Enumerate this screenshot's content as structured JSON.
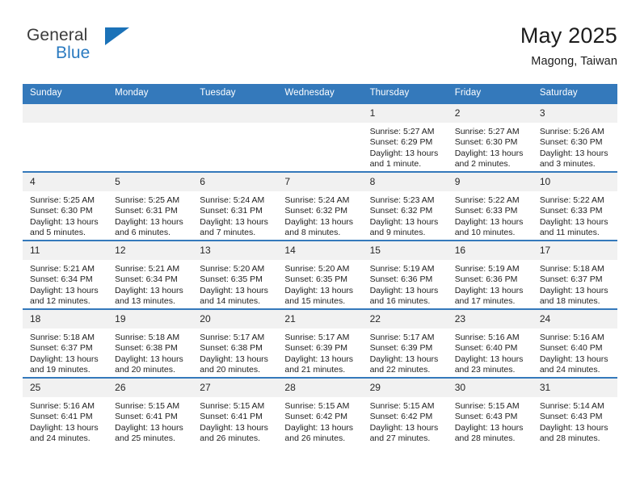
{
  "brand": {
    "name_part1": "General",
    "name_part2": "Blue",
    "mark": "triangle-flag-icon"
  },
  "header": {
    "title": "May 2025",
    "location": "Magong, Taiwan"
  },
  "weekday_headers": [
    "Sunday",
    "Monday",
    "Tuesday",
    "Wednesday",
    "Thursday",
    "Friday",
    "Saturday"
  ],
  "colors": {
    "header_blue": "#3479bb",
    "brand_blue": "#2a7ac0",
    "daynum_band": "#f1f1f1",
    "text": "#1f1f1f"
  },
  "labels": {
    "sunrise_prefix": "Sunrise:",
    "sunset_prefix": "Sunset:",
    "daylight_prefix": "Daylight:"
  },
  "weeks": [
    [
      {
        "day": "",
        "sunrise": "",
        "sunset": "",
        "daylight": "",
        "empty": true
      },
      {
        "day": "",
        "sunrise": "",
        "sunset": "",
        "daylight": "",
        "empty": true
      },
      {
        "day": "",
        "sunrise": "",
        "sunset": "",
        "daylight": "",
        "empty": true
      },
      {
        "day": "",
        "sunrise": "",
        "sunset": "",
        "daylight": "",
        "empty": true
      },
      {
        "day": "1",
        "sunrise": "Sunrise: 5:27 AM",
        "sunset": "Sunset: 6:29 PM",
        "daylight": "Daylight: 13 hours and 1 minute.",
        "empty": false
      },
      {
        "day": "2",
        "sunrise": "Sunrise: 5:27 AM",
        "sunset": "Sunset: 6:30 PM",
        "daylight": "Daylight: 13 hours and 2 minutes.",
        "empty": false
      },
      {
        "day": "3",
        "sunrise": "Sunrise: 5:26 AM",
        "sunset": "Sunset: 6:30 PM",
        "daylight": "Daylight: 13 hours and 3 minutes.",
        "empty": false
      }
    ],
    [
      {
        "day": "4",
        "sunrise": "Sunrise: 5:25 AM",
        "sunset": "Sunset: 6:30 PM",
        "daylight": "Daylight: 13 hours and 5 minutes.",
        "empty": false
      },
      {
        "day": "5",
        "sunrise": "Sunrise: 5:25 AM",
        "sunset": "Sunset: 6:31 PM",
        "daylight": "Daylight: 13 hours and 6 minutes.",
        "empty": false
      },
      {
        "day": "6",
        "sunrise": "Sunrise: 5:24 AM",
        "sunset": "Sunset: 6:31 PM",
        "daylight": "Daylight: 13 hours and 7 minutes.",
        "empty": false
      },
      {
        "day": "7",
        "sunrise": "Sunrise: 5:24 AM",
        "sunset": "Sunset: 6:32 PM",
        "daylight": "Daylight: 13 hours and 8 minutes.",
        "empty": false
      },
      {
        "day": "8",
        "sunrise": "Sunrise: 5:23 AM",
        "sunset": "Sunset: 6:32 PM",
        "daylight": "Daylight: 13 hours and 9 minutes.",
        "empty": false
      },
      {
        "day": "9",
        "sunrise": "Sunrise: 5:22 AM",
        "sunset": "Sunset: 6:33 PM",
        "daylight": "Daylight: 13 hours and 10 minutes.",
        "empty": false
      },
      {
        "day": "10",
        "sunrise": "Sunrise: 5:22 AM",
        "sunset": "Sunset: 6:33 PM",
        "daylight": "Daylight: 13 hours and 11 minutes.",
        "empty": false
      }
    ],
    [
      {
        "day": "11",
        "sunrise": "Sunrise: 5:21 AM",
        "sunset": "Sunset: 6:34 PM",
        "daylight": "Daylight: 13 hours and 12 minutes.",
        "empty": false
      },
      {
        "day": "12",
        "sunrise": "Sunrise: 5:21 AM",
        "sunset": "Sunset: 6:34 PM",
        "daylight": "Daylight: 13 hours and 13 minutes.",
        "empty": false
      },
      {
        "day": "13",
        "sunrise": "Sunrise: 5:20 AM",
        "sunset": "Sunset: 6:35 PM",
        "daylight": "Daylight: 13 hours and 14 minutes.",
        "empty": false
      },
      {
        "day": "14",
        "sunrise": "Sunrise: 5:20 AM",
        "sunset": "Sunset: 6:35 PM",
        "daylight": "Daylight: 13 hours and 15 minutes.",
        "empty": false
      },
      {
        "day": "15",
        "sunrise": "Sunrise: 5:19 AM",
        "sunset": "Sunset: 6:36 PM",
        "daylight": "Daylight: 13 hours and 16 minutes.",
        "empty": false
      },
      {
        "day": "16",
        "sunrise": "Sunrise: 5:19 AM",
        "sunset": "Sunset: 6:36 PM",
        "daylight": "Daylight: 13 hours and 17 minutes.",
        "empty": false
      },
      {
        "day": "17",
        "sunrise": "Sunrise: 5:18 AM",
        "sunset": "Sunset: 6:37 PM",
        "daylight": "Daylight: 13 hours and 18 minutes.",
        "empty": false
      }
    ],
    [
      {
        "day": "18",
        "sunrise": "Sunrise: 5:18 AM",
        "sunset": "Sunset: 6:37 PM",
        "daylight": "Daylight: 13 hours and 19 minutes.",
        "empty": false
      },
      {
        "day": "19",
        "sunrise": "Sunrise: 5:18 AM",
        "sunset": "Sunset: 6:38 PM",
        "daylight": "Daylight: 13 hours and 20 minutes.",
        "empty": false
      },
      {
        "day": "20",
        "sunrise": "Sunrise: 5:17 AM",
        "sunset": "Sunset: 6:38 PM",
        "daylight": "Daylight: 13 hours and 20 minutes.",
        "empty": false
      },
      {
        "day": "21",
        "sunrise": "Sunrise: 5:17 AM",
        "sunset": "Sunset: 6:39 PM",
        "daylight": "Daylight: 13 hours and 21 minutes.",
        "empty": false
      },
      {
        "day": "22",
        "sunrise": "Sunrise: 5:17 AM",
        "sunset": "Sunset: 6:39 PM",
        "daylight": "Daylight: 13 hours and 22 minutes.",
        "empty": false
      },
      {
        "day": "23",
        "sunrise": "Sunrise: 5:16 AM",
        "sunset": "Sunset: 6:40 PM",
        "daylight": "Daylight: 13 hours and 23 minutes.",
        "empty": false
      },
      {
        "day": "24",
        "sunrise": "Sunrise: 5:16 AM",
        "sunset": "Sunset: 6:40 PM",
        "daylight": "Daylight: 13 hours and 24 minutes.",
        "empty": false
      }
    ],
    [
      {
        "day": "25",
        "sunrise": "Sunrise: 5:16 AM",
        "sunset": "Sunset: 6:41 PM",
        "daylight": "Daylight: 13 hours and 24 minutes.",
        "empty": false
      },
      {
        "day": "26",
        "sunrise": "Sunrise: 5:15 AM",
        "sunset": "Sunset: 6:41 PM",
        "daylight": "Daylight: 13 hours and 25 minutes.",
        "empty": false
      },
      {
        "day": "27",
        "sunrise": "Sunrise: 5:15 AM",
        "sunset": "Sunset: 6:41 PM",
        "daylight": "Daylight: 13 hours and 26 minutes.",
        "empty": false
      },
      {
        "day": "28",
        "sunrise": "Sunrise: 5:15 AM",
        "sunset": "Sunset: 6:42 PM",
        "daylight": "Daylight: 13 hours and 26 minutes.",
        "empty": false
      },
      {
        "day": "29",
        "sunrise": "Sunrise: 5:15 AM",
        "sunset": "Sunset: 6:42 PM",
        "daylight": "Daylight: 13 hours and 27 minutes.",
        "empty": false
      },
      {
        "day": "30",
        "sunrise": "Sunrise: 5:15 AM",
        "sunset": "Sunset: 6:43 PM",
        "daylight": "Daylight: 13 hours and 28 minutes.",
        "empty": false
      },
      {
        "day": "31",
        "sunrise": "Sunrise: 5:14 AM",
        "sunset": "Sunset: 6:43 PM",
        "daylight": "Daylight: 13 hours and 28 minutes.",
        "empty": false
      }
    ]
  ]
}
